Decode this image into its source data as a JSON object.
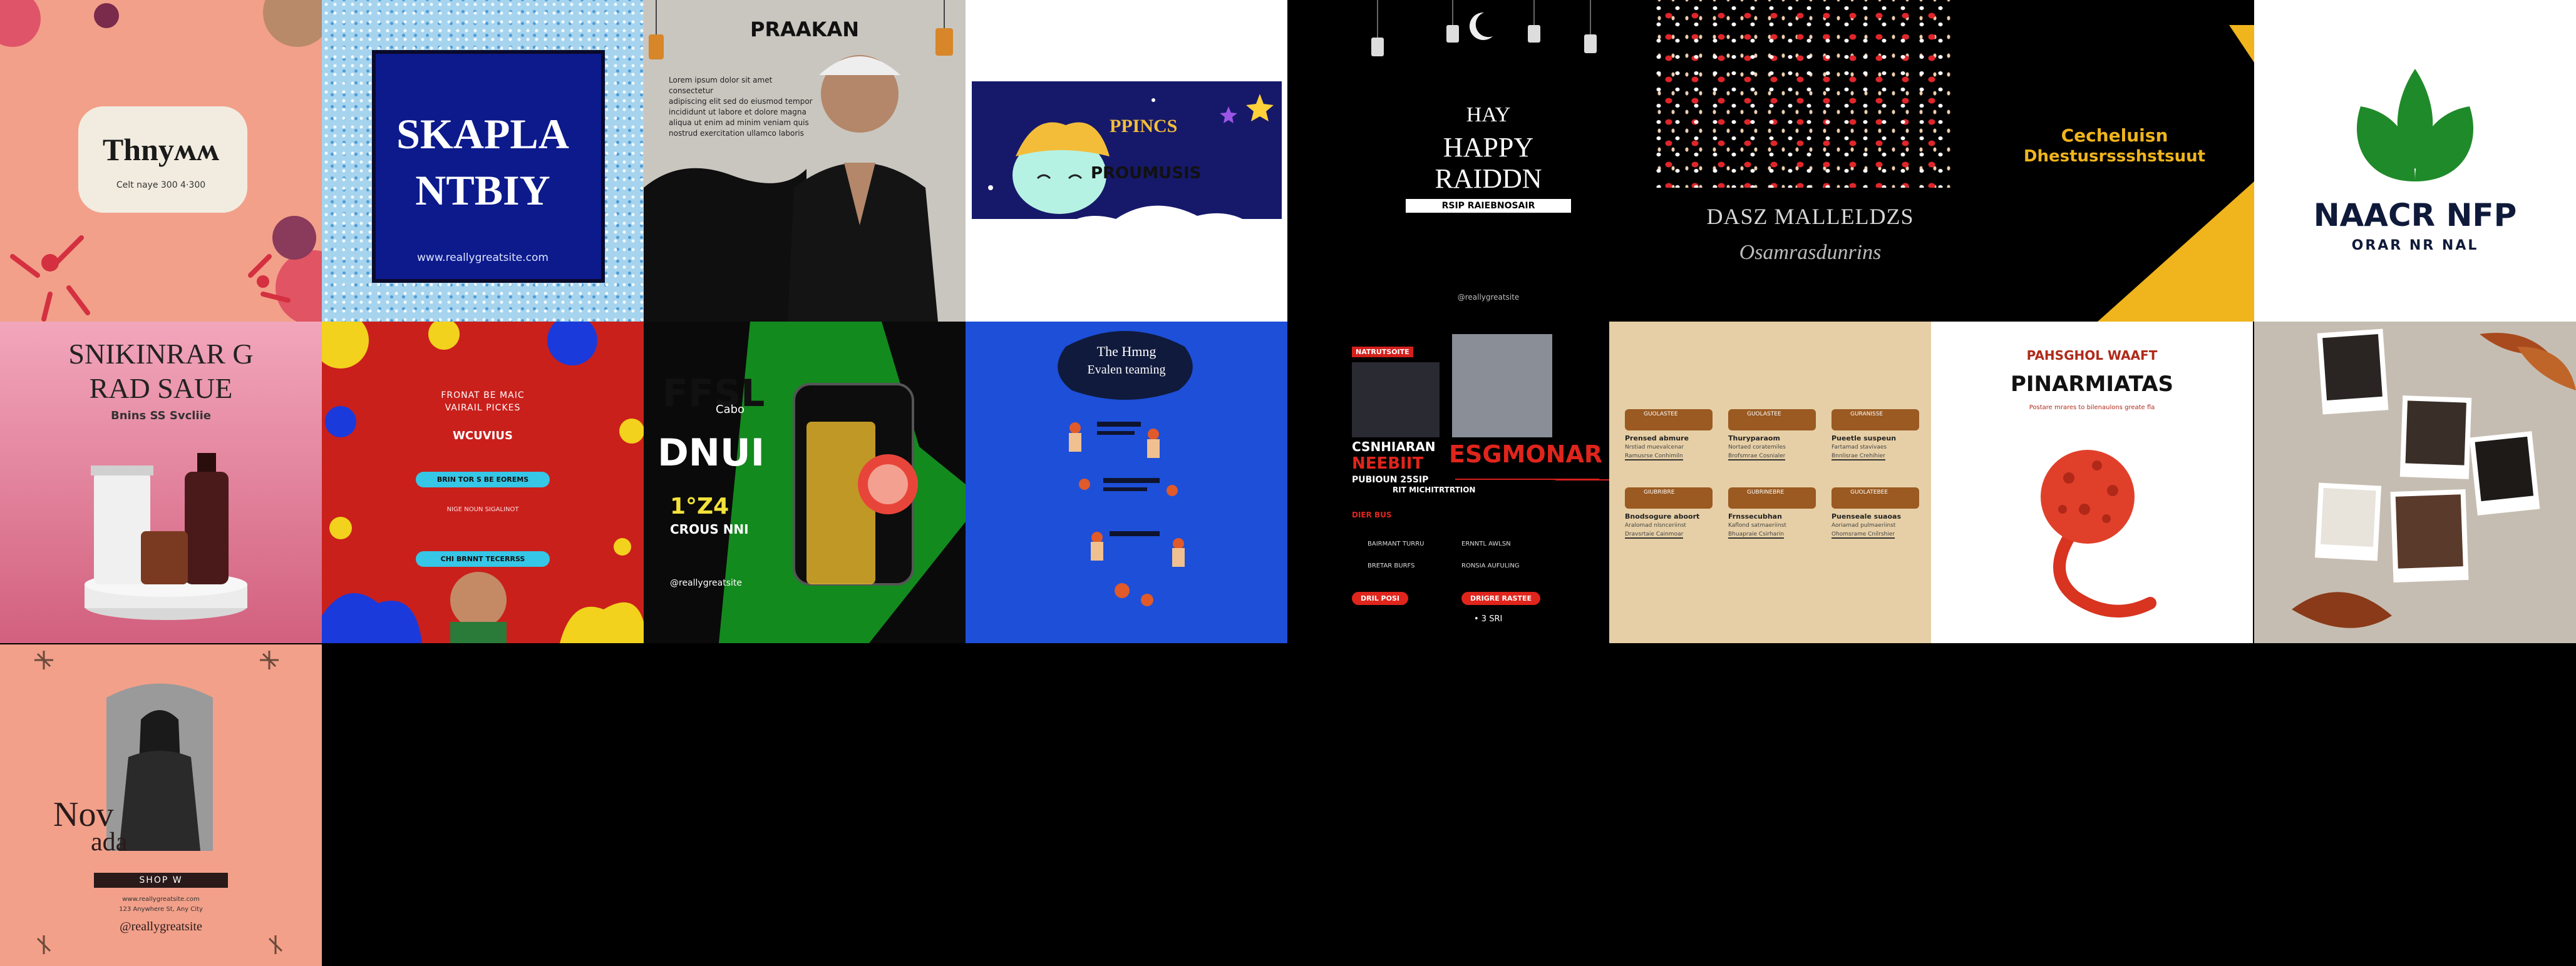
{
  "tiles": {
    "t1": {
      "title": "Thnyʍʍ",
      "sub": "Celt naye 300 4·300"
    },
    "t2": {
      "title": "SKAPLA",
      "title2": "NTBIY",
      "url": "www.reallygreatsite.com"
    },
    "t3": {
      "title": "PRAAKAN",
      "body": [
        "Lorem ipsum dolor sit amet consectetur",
        "adipiscing elit sed do eiusmod tempor",
        "incididunt ut labore et dolore magna",
        "aliqua ut enim ad minim veniam quis",
        "nostrud exercitation ullamco laboris"
      ]
    },
    "t4": {
      "title": "PPINCS",
      "sub": "PROUMUSIS"
    },
    "t5": {
      "title1": "HAY",
      "title2": "HAPPY",
      "title3": "RAIDDN",
      "tag": "RSIP RAIEBNOSAIR",
      "foot": "@reallygreatsite"
    },
    "t6": {
      "title": "DASZ MALLELDZS",
      "sub": "Osamrasdunrins"
    },
    "t7": {
      "title": "Cecheluisn",
      "sub": "Dhestusrssshstsuut"
    },
    "t8": {
      "title": "NAACR NFP",
      "sub": "ORAR NR NAL"
    },
    "t9": {
      "title": "SNIKINRAR G",
      "title2": "RAD SAUE",
      "sub": "Bnins SS Svcliie"
    },
    "t10": {
      "line1": "FRONAT BE MAIC",
      "line2": "VAIRAIL PICKES",
      "brand": "WCUVIUS",
      "btn1": "BRIN TOR S BE EOREMS",
      "small": "NIGE NOUN SIGALINOT",
      "btn2": "CHI BRNNT TECERRSS"
    },
    "t11": {
      "title": "FFSL",
      "sub": "Cabo",
      "big": "DNUI",
      "price": "1°Z4",
      "promo": "CROUS NNI",
      "url": "@reallygreatsite"
    },
    "t12": {
      "title1": "The Hmng",
      "title2": "Evalen teaming"
    },
    "t13": {
      "tag": "NATRUTSOITE",
      "h1": "CSNHIARAN",
      "h2": "NEEBIIT",
      "h3": "ESGMONAR",
      "date": "PUBIOUN 25SIP",
      "sect": "RIT MICHITRTRTION",
      "label": "DIER BUS",
      "item1": "BAIRMANT TURRU",
      "item2": "ERNNTL AWLSN",
      "item3": "BRETAR BURFS",
      "item4": "RONSIA AUFULING",
      "btn1": "DRIL POSI",
      "btn2": "DRIGRE RASTEE",
      "price": "• 3 SRI"
    },
    "t14": {
      "cards": [
        {
          "tag": "GUOLASTEE",
          "title": "Prensed abmure",
          "text": "Nrstiad muevalcenar",
          "line": "Ramusrse Conhimiln"
        },
        {
          "tag": "GUOLASTEE",
          "title": "Thuryparaom",
          "text": "Nortaed coratemiles",
          "line": "Brofsmrae Cosnialer"
        },
        {
          "tag": "GURANISSE",
          "title": "Pueetle suspeun",
          "text": "Fartamad stavivaes",
          "line": "Bnnlisrae Crehihier"
        },
        {
          "tag": "GIUBRIBRE",
          "title": "Bnodsogure aboort",
          "text": "Aralomad nlsnceriinst",
          "line": "Dravsrtaie Cainmoar"
        },
        {
          "tag": "GUBRINEBRE",
          "title": "Frnssecubhan",
          "text": "Kaflond satmaeriinst",
          "line": "Bhuapraie Csirharin"
        },
        {
          "tag": "GUOLATEBEE",
          "title": "Puenseale suaoas",
          "text": "Aoriamad pulmaeriinst",
          "line": "Ohomsrame Cnilrshier"
        }
      ]
    },
    "t15": {
      "kicker": "PAHSGHOL WAAFT",
      "title": "PINARMIATAS",
      "sub": "Postare mrares to bilenaulons greate fla"
    },
    "t17": {
      "title": "Nov",
      "title2": "ada",
      "btn": "SHOP W",
      "info1": "www.reallygreatsite.com",
      "info2": "123 Anywhere St, Any City",
      "handle": "@reallygreatsite"
    }
  },
  "colors": {
    "black": "#000000",
    "coral": "#f2a08a",
    "navy": "#0c1a8c",
    "red": "#c9201c",
    "green": "#138a1e",
    "blue": "#1d4fd8",
    "gold": "#f0b41c",
    "leaf": "#1f8a2a",
    "tan": "#e6cfa6"
  }
}
